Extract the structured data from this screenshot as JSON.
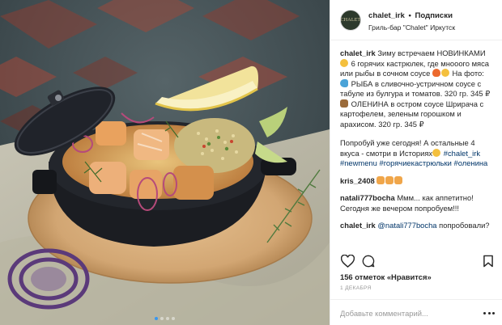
{
  "header": {
    "avatar_text": "CHALET",
    "username": "chalet_irk",
    "separator": "•",
    "follow_label": "Подписки",
    "location": "Гриль-бар \"Chalet\" Иркутск"
  },
  "caption": {
    "username": "chalet_irk",
    "line1": "Зиму встречаем НОВИНКАМИ",
    "line2": "6 горячих кастрюлек, где мнооого мяса или рыбы в сочном соусе",
    "line3": "На фото:",
    "fish_item": "РЫБА в сливочно-устричном соусе с табуле из булгура и томатов. 320 гр. 345 ₽",
    "deer_item": "ОЛЕНИНА в остром соусе Шрирача с картофелем, зеленым горошком и арахисом. 320 гр. 345 ₽",
    "cta": "Попробуй уже сегодня! А остальные 4 вкуса - смотри в Историях",
    "hashtag1": "#chalet_irk",
    "hashtag2": "#newmenu",
    "hashtag3": "#горячиекастрюльки",
    "hashtag4": "#оленина"
  },
  "comments": [
    {
      "username": "kris_2408",
      "text": ""
    },
    {
      "username": "natali777bocha",
      "text": "Ммм... как аппетитно! Сегодня же вечером попробуем!!!"
    },
    {
      "username": "chalet_irk",
      "mention": "@natali777bocha",
      "text": "попробовали?"
    }
  ],
  "actions": {
    "like_icon": "heart-icon",
    "comment_icon": "comment-icon",
    "save_icon": "bookmark-icon"
  },
  "likes": "156 отметок «Нравится»",
  "date": "1 ДЕКАБРЯ",
  "add_comment": {
    "placeholder": "Добавьте комментарий..."
  },
  "carousel": {
    "count": 4,
    "active_index": 0
  },
  "colors": {
    "accent": "#3897f0",
    "hashtag": "#003569",
    "text": "#262626",
    "muted": "#999999"
  }
}
